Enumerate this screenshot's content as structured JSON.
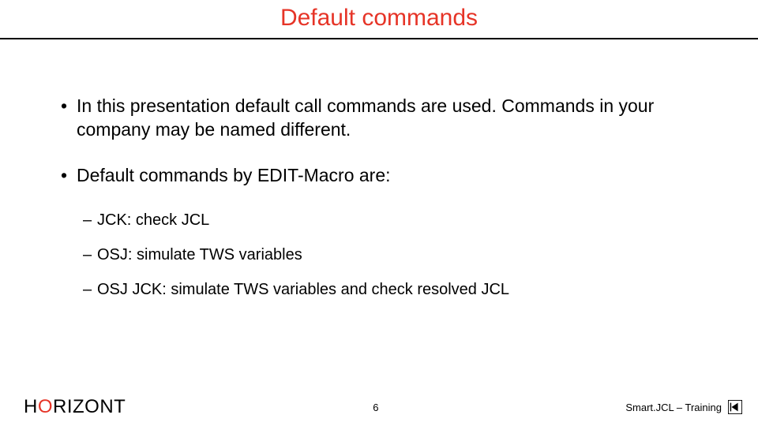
{
  "title": "Default commands",
  "bullets": {
    "b1": "In this presentation default call commands are used. Commands in your company may be named different.",
    "b2": "Default commands by EDIT-Macro are:",
    "sub1": "JCK: check JCL",
    "sub2": "OSJ: simulate TWS variables",
    "sub3": "OSJ JCK: simulate TWS variables and check resolved JCL"
  },
  "footer": {
    "brand_h": "H",
    "brand_o": "O",
    "brand_rest": "RIZONT",
    "page": "6",
    "right_text": "Smart.JCL – Training"
  }
}
